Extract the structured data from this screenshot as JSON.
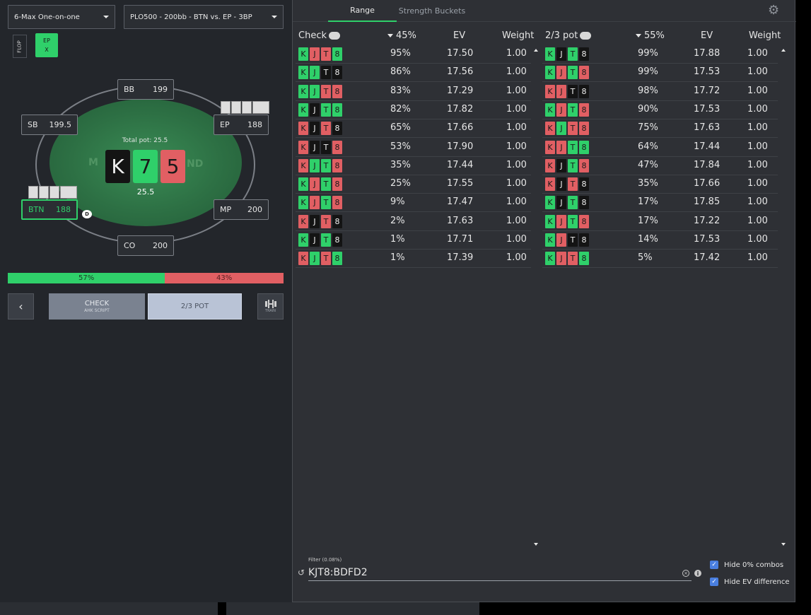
{
  "left": {
    "game_select": "6-Max One-on-one",
    "spot_select": "PLO500 - 200bb - BTN vs. EP - 3BP",
    "street_label": "FLOP",
    "action_chip": {
      "line1": "EP",
      "line2": "X"
    },
    "watermark_left": "M",
    "watermark_right": "ND",
    "total_pot_label": "Total pot: 25.5",
    "pot_amount": "25.5",
    "board": [
      {
        "rank": "K",
        "color": "#141414",
        "text": "#f0f0f0"
      },
      {
        "rank": "7",
        "color": "#2fd06a",
        "text": "#1a1a1a"
      },
      {
        "rank": "5",
        "color": "#e15f63",
        "text": "#1a1a1a"
      }
    ],
    "seats": {
      "bb": {
        "name": "BB",
        "stack": "199"
      },
      "sb": {
        "name": "SB",
        "stack": "199.5"
      },
      "ep": {
        "name": "EP",
        "stack": "188"
      },
      "btn": {
        "name": "BTN",
        "stack": "188"
      },
      "mp": {
        "name": "MP",
        "stack": "200"
      },
      "co": {
        "name": "CO",
        "stack": "200"
      }
    },
    "dealer_label": "D",
    "freq": {
      "check_pct": 57,
      "check_label": "57%",
      "bet_label": "43%"
    },
    "buttons": {
      "back": "‹",
      "check": "CHECK",
      "check_sub": "AHK SCRIPT",
      "bet": "2/3 POT",
      "train_sub": "TRAIN"
    }
  },
  "right": {
    "tabs": [
      "Range",
      "Strength Buckets"
    ],
    "check_table": {
      "action": "Check",
      "freq": "45%",
      "ev_header": "EV",
      "weight_header": "Weight",
      "rows": [
        {
          "cards": [
            "g",
            "r",
            "r",
            "g"
          ],
          "pct": "95%",
          "ev": "17.50",
          "w": "1.00"
        },
        {
          "cards": [
            "g",
            "g",
            "b",
            "b"
          ],
          "pct": "86%",
          "ev": "17.56",
          "w": "1.00"
        },
        {
          "cards": [
            "g",
            "g",
            "r",
            "r"
          ],
          "pct": "83%",
          "ev": "17.29",
          "w": "1.00"
        },
        {
          "cards": [
            "g",
            "b",
            "g",
            "g"
          ],
          "pct": "82%",
          "ev": "17.82",
          "w": "1.00"
        },
        {
          "cards": [
            "r",
            "b",
            "r",
            "b"
          ],
          "pct": "65%",
          "ev": "17.66",
          "w": "1.00"
        },
        {
          "cards": [
            "r",
            "b",
            "b",
            "r"
          ],
          "pct": "53%",
          "ev": "17.90",
          "w": "1.00"
        },
        {
          "cards": [
            "r",
            "g",
            "g",
            "r"
          ],
          "pct": "35%",
          "ev": "17.44",
          "w": "1.00"
        },
        {
          "cards": [
            "g",
            "r",
            "g",
            "r"
          ],
          "pct": "25%",
          "ev": "17.55",
          "w": "1.00"
        },
        {
          "cards": [
            "g",
            "r",
            "g",
            "r"
          ],
          "pct": "9%",
          "ev": "17.47",
          "w": "1.00"
        },
        {
          "cards": [
            "r",
            "b",
            "r",
            "b"
          ],
          "pct": "2%",
          "ev": "17.63",
          "w": "1.00"
        },
        {
          "cards": [
            "g",
            "b",
            "g",
            "b"
          ],
          "pct": "1%",
          "ev": "17.71",
          "w": "1.00"
        },
        {
          "cards": [
            "r",
            "g",
            "r",
            "g"
          ],
          "pct": "1%",
          "ev": "17.39",
          "w": "1.00"
        }
      ]
    },
    "bet_table": {
      "action": "2/3 pot",
      "freq": "55%",
      "ev_header": "EV",
      "weight_header": "Weight",
      "rows": [
        {
          "cards": [
            "g",
            "b",
            "g",
            "b"
          ],
          "pct": "99%",
          "ev": "17.88",
          "w": "1.00"
        },
        {
          "cards": [
            "g",
            "r",
            "g",
            "r"
          ],
          "pct": "99%",
          "ev": "17.53",
          "w": "1.00"
        },
        {
          "cards": [
            "r",
            "r",
            "b",
            "b"
          ],
          "pct": "98%",
          "ev": "17.72",
          "w": "1.00"
        },
        {
          "cards": [
            "g",
            "r",
            "g",
            "r"
          ],
          "pct": "90%",
          "ev": "17.53",
          "w": "1.00"
        },
        {
          "cards": [
            "r",
            "g",
            "r",
            "r"
          ],
          "pct": "75%",
          "ev": "17.63",
          "w": "1.00"
        },
        {
          "cards": [
            "r",
            "r",
            "g",
            "g"
          ],
          "pct": "64%",
          "ev": "17.44",
          "w": "1.00"
        },
        {
          "cards": [
            "r",
            "b",
            "g",
            "r"
          ],
          "pct": "47%",
          "ev": "17.84",
          "w": "1.00"
        },
        {
          "cards": [
            "r",
            "b",
            "r",
            "b"
          ],
          "pct": "35%",
          "ev": "17.66",
          "w": "1.00"
        },
        {
          "cards": [
            "g",
            "b",
            "g",
            "b"
          ],
          "pct": "17%",
          "ev": "17.85",
          "w": "1.00"
        },
        {
          "cards": [
            "g",
            "r",
            "g",
            "r"
          ],
          "pct": "17%",
          "ev": "17.22",
          "w": "1.00"
        },
        {
          "cards": [
            "g",
            "r",
            "b",
            "b"
          ],
          "pct": "14%",
          "ev": "17.53",
          "w": "1.00"
        },
        {
          "cards": [
            "g",
            "r",
            "r",
            "g"
          ],
          "pct": "5%",
          "ev": "17.42",
          "w": "1.00"
        }
      ]
    },
    "card_ranks": [
      "K",
      "J",
      "T",
      "8"
    ],
    "filter": {
      "label": "Filter (0.08%)",
      "value": "KJT8:BDFD2"
    },
    "checkboxes": {
      "hide_zero": "Hide 0% combos",
      "hide_ev": "Hide EV difference"
    }
  },
  "colors": {
    "green": "#2fd06a",
    "red": "#e15f63",
    "black": "#141414"
  },
  "icons": [
    "gear-icon",
    "cloud-download-icon",
    "sort-down-icon",
    "reset-icon",
    "clear-icon",
    "info-icon",
    "dumbbell-icon",
    "chevron-left-icon"
  ]
}
